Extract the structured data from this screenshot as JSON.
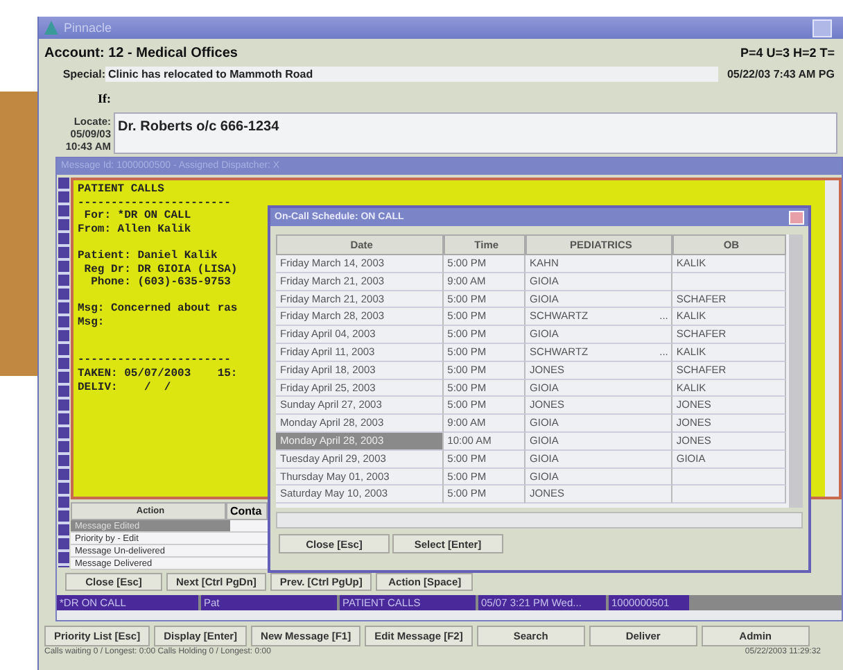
{
  "window": {
    "title": "Pinnacle"
  },
  "account": {
    "label": "Account: 12 - Medical Offices",
    "counts": "P=4  U=3  H=2  T=",
    "special_label": "Special:",
    "special": "Clinic has relocated to Mammoth Road",
    "stamp": "05/22/03 7:43 AM PG",
    "if_label": "If:",
    "locate_label": "Locate:",
    "locate_date": "05/09/03",
    "locate_time": "10:43 AM",
    "locate": "Dr. Roberts o/c 666-1234"
  },
  "message_window": {
    "title": "Message Id: 1000000500 - Assigned Dispatcher: X",
    "blocks": [
      [
        "PATIENT CALLS",
        "-----------------------",
        " For: *DR ON CALL",
        "From: Allen Kalik"
      ],
      [
        "Patient: Daniel Kalik",
        " Reg Dr: DR GIOIA (LISA)",
        "  Phone: (603)-635-9753"
      ],
      [
        "Msg: Concerned about ras",
        "Msg:"
      ],
      [
        "-----------------------",
        "TAKEN: 05/07/2003    15:",
        "DELIV:    /  /"
      ]
    ],
    "action_columns": [
      "Action",
      "Conta"
    ],
    "actions": [
      {
        "label": "Message Edited",
        "selected": true
      },
      {
        "label": "Priority by - Edit",
        "selected": false
      },
      {
        "label": "Message Un-delivered",
        "selected": false
      },
      {
        "label": "Message Delivered",
        "selected": false
      }
    ],
    "buttons": [
      "Close [Esc]",
      "Next [Ctrl PgDn]",
      "Prev. [Ctrl PgUp]",
      "Action [Space]"
    ],
    "status_cells": [
      "*DR ON CALL",
      "Pat",
      "PATIENT CALLS",
      "05/07 3:21 PM Wed...",
      "1000000501"
    ]
  },
  "dialog": {
    "title": "On-Call Schedule: ON CALL",
    "columns": [
      "Date",
      "Time",
      "PEDIATRICS",
      "OB"
    ],
    "rows": [
      {
        "date": "Friday March 14, 2003",
        "time": "5:00 PM",
        "pediatrics": "KAHN",
        "ob": "KALIK",
        "more": false,
        "selected": false
      },
      {
        "date": "Friday March 21, 2003",
        "time": "9:00 AM",
        "pediatrics": "GIOIA",
        "more": false,
        "selected": false
      },
      {
        "date": "Friday March 21, 2003",
        "time": "5:00 PM",
        "pediatrics": "GIOIA",
        "ob": "SCHAFER",
        "more": false,
        "selected": false
      },
      {
        "date": "Friday March 28, 2003",
        "time": "5:00 PM",
        "pediatrics": "SCHWARTZ",
        "ob": "KALIK",
        "more": true,
        "selected": false
      },
      {
        "date": "Friday April 04, 2003",
        "time": "5:00 PM",
        "pediatrics": "GIOIA",
        "ob": "SCHAFER",
        "more": false,
        "selected": false
      },
      {
        "date": "Friday April 11, 2003",
        "time": "5:00 PM",
        "pediatrics": "SCHWARTZ",
        "ob": "KALIK",
        "more": true,
        "selected": false
      },
      {
        "date": "Friday April 18, 2003",
        "time": "5:00 PM",
        "pediatrics": "JONES",
        "ob": "SCHAFER",
        "more": false,
        "selected": false
      },
      {
        "date": "Friday April 25, 2003",
        "time": "5:00 PM",
        "pediatrics": "GIOIA",
        "ob": "KALIK",
        "more": false,
        "selected": false
      },
      {
        "date": "Sunday April 27, 2003",
        "time": "5:00 PM",
        "pediatrics": "JONES",
        "ob": "JONES",
        "more": false,
        "selected": false
      },
      {
        "date": "Monday April 28, 2003",
        "time": "9:00 AM",
        "pediatrics": "GIOIA",
        "ob": "JONES",
        "more": false,
        "selected": false
      },
      {
        "date": "Monday April 28, 2003",
        "time": "10:00 AM",
        "pediatrics": "GIOIA",
        "ob": "JONES",
        "more": false,
        "selected": true
      },
      {
        "date": "Tuesday April 29, 2003",
        "time": "5:00 PM",
        "pediatrics": "GIOIA",
        "ob": "GIOIA",
        "more": false,
        "selected": false
      },
      {
        "date": "Thursday May 01, 2003",
        "time": "5:00 PM",
        "pediatrics": "GIOIA",
        "more": false,
        "selected": false
      },
      {
        "date": "Saturday May 10, 2003",
        "time": "5:00 PM",
        "pediatrics": "JONES",
        "more": false,
        "selected": false
      }
    ],
    "more_label": "...",
    "buttons": [
      "Close [Esc]",
      "Select [Enter]"
    ]
  },
  "toolbar": [
    "Priority List [Esc]",
    "Display [Enter]",
    "New Message [F1]",
    "Edit Message [F2]",
    "Search",
    "Deliver",
    "Admin"
  ],
  "status_bar": {
    "calls": "Calls waiting 0 / Longest: 0:00    Calls Holding 0 / Longest: 0:00",
    "clock": "05/22/2003 11:29:32"
  }
}
